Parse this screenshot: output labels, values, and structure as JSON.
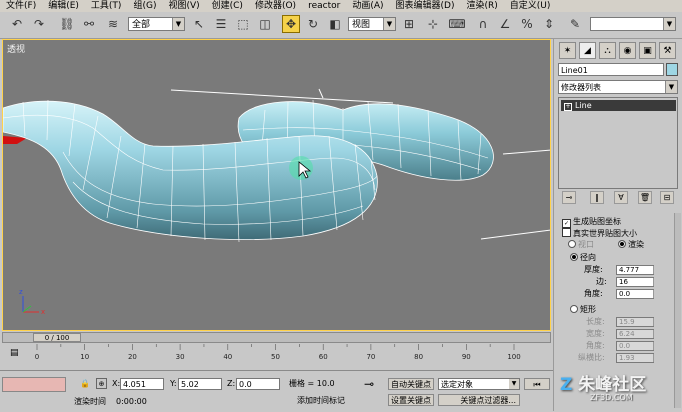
{
  "menu": [
    "文件(F)",
    "编辑(E)",
    "工具(T)",
    "组(G)",
    "视图(V)",
    "创建(C)",
    "修改器(O)",
    "reactor",
    "动画(A)",
    "图表编辑器(D)",
    "渲染(R)",
    "自定义(U)"
  ],
  "toolbar": {
    "selection_filter": "全部",
    "ref_coord": "视图",
    "named_set": ""
  },
  "viewport": {
    "label": "透视",
    "background": "#7a7a7a",
    "object_color": "#9ed6e4"
  },
  "panel": {
    "object_name": "Line01",
    "modifier_list": "修改器列表",
    "stack_item": "Line",
    "gen_mapping": "生成贴图坐标",
    "real_world": "真实世界贴图大小",
    "viewport_opt": "视口",
    "render_opt": "渲染",
    "radial": "径向",
    "thickness_label": "厚度:",
    "thickness": "4.777",
    "sides_label": "边:",
    "sides": "16",
    "angle_label": "角度:",
    "angle": "0.0",
    "rect": "矩形",
    "length_label": "长度:",
    "length": "15.9",
    "width_label": "宽度:",
    "width": "6.24",
    "angle2_label": "角度:",
    "angle2": "0.0",
    "aspect_label": "纵横比:",
    "aspect": "1.93"
  },
  "timeline": {
    "frame": "0 / 100",
    "ticks": [
      "0",
      "10",
      "20",
      "30",
      "40",
      "50",
      "60",
      "70",
      "80",
      "90",
      "100"
    ]
  },
  "status": {
    "x_label": "X:",
    "x": "4.051",
    "y_label": "Y:",
    "y": "5.02",
    "z_label": "Z:",
    "z": "0.0",
    "grid": "栅格 = 10.0",
    "auto_key": "自动关键点",
    "selected": "选定对象",
    "set_key": "设置关键点",
    "key_filter": "关键点过滤器...",
    "render_time": "渲染时间",
    "time": "0:00:00",
    "add_time_tag": "添加时间标记"
  },
  "watermark": {
    "logo": "朱峰社区",
    "url": "ZF3D.COM"
  }
}
